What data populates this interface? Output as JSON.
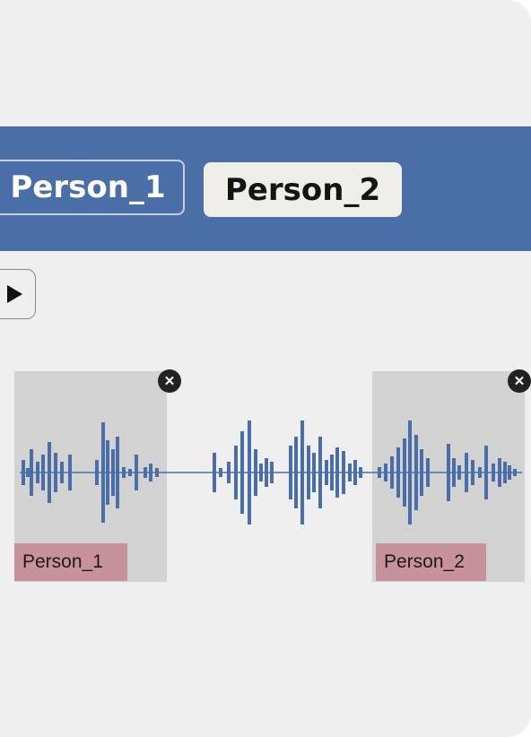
{
  "tabs": [
    {
      "label": "Person_1",
      "selected": false
    },
    {
      "label": "Person_2",
      "selected": true
    }
  ],
  "player": {
    "play_icon": "play-icon"
  },
  "timeline": {
    "segments": [
      {
        "label": "Person_1",
        "remove_icon": "close-icon"
      },
      {
        "label": "Person_2",
        "remove_icon": "close-icon"
      }
    ]
  },
  "colors": {
    "header": "#4a6ea8",
    "waveform": "#4a6ea8",
    "segment_bg": "#d2d2d2",
    "segment_label": "#c8929c",
    "background": "#efefef"
  }
}
